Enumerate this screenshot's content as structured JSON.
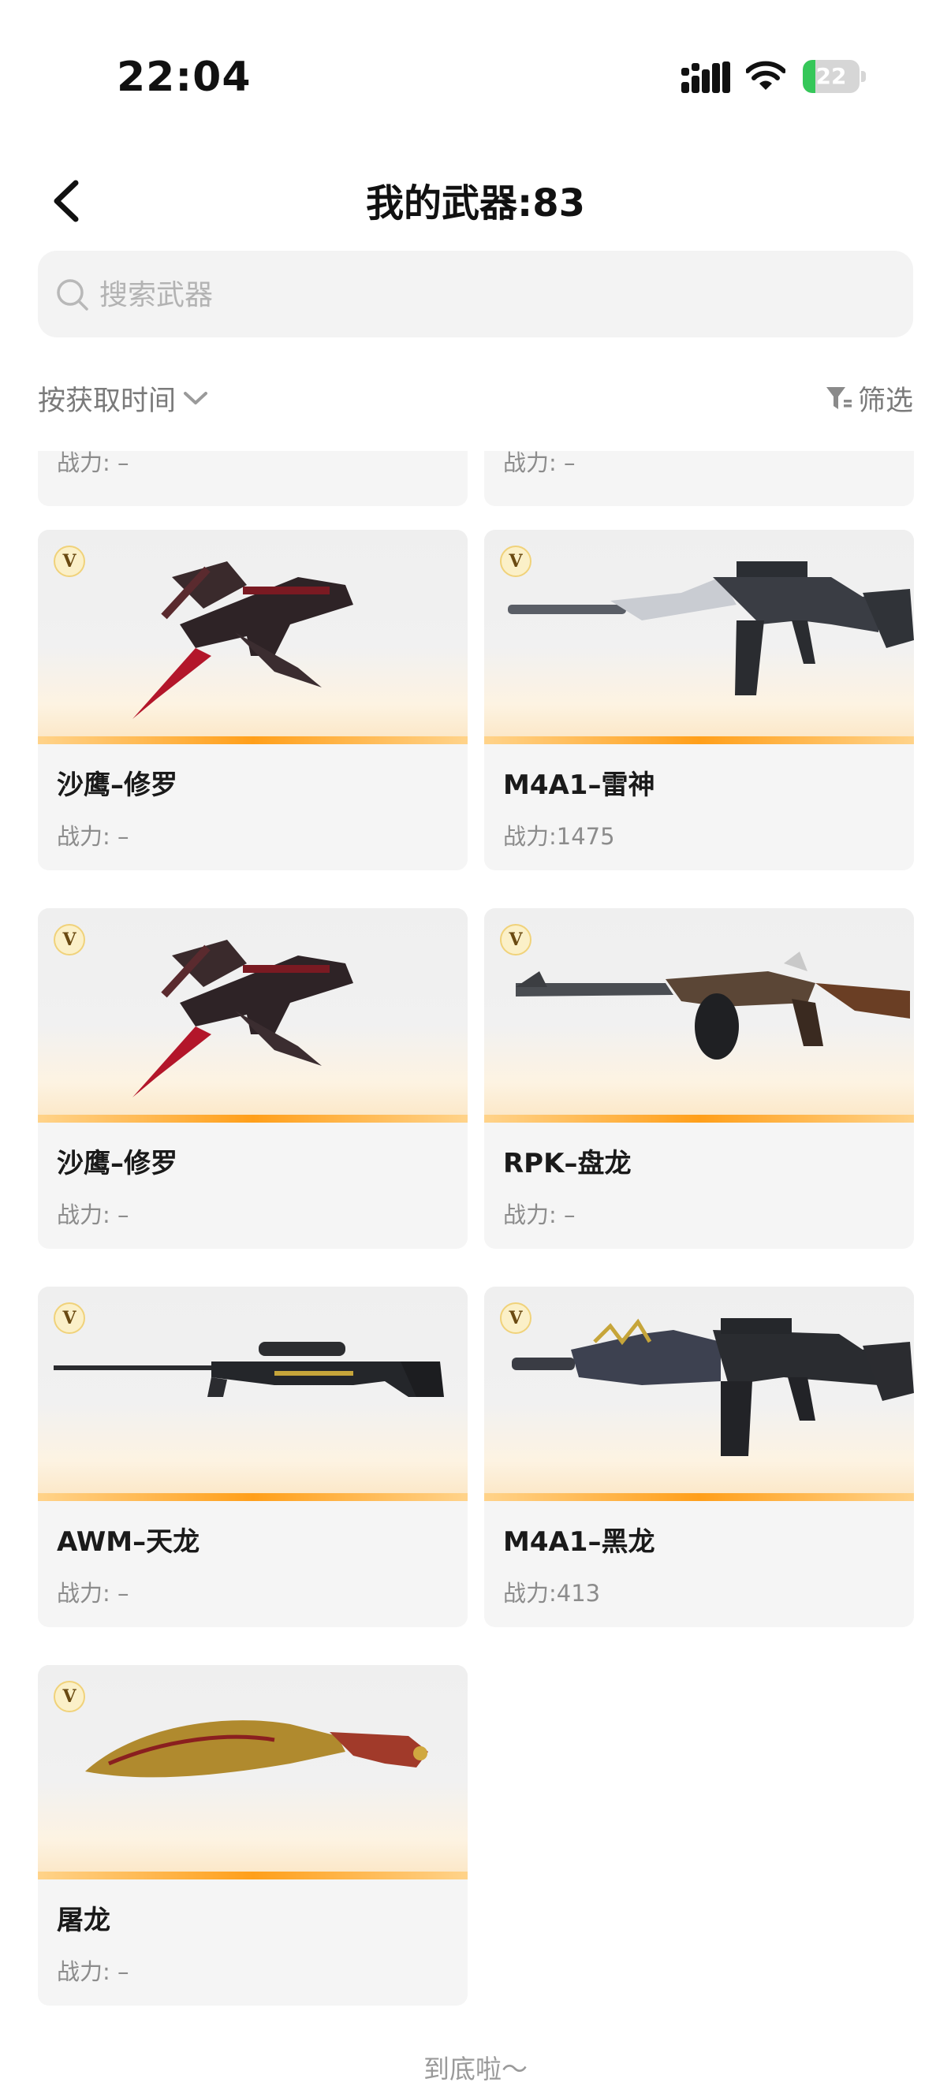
{
  "status_bar": {
    "time": "22:04",
    "battery_level": "22",
    "battery_fraction": 0.22,
    "icons": [
      "signal-icon",
      "wifi-icon",
      "battery-icon"
    ]
  },
  "header": {
    "title": "我的武器:83",
    "back_icon": "chevron-left-icon"
  },
  "search": {
    "placeholder": "搜索武器"
  },
  "toolbar": {
    "sort_label": "按获取时间",
    "filter_label": "筛选"
  },
  "partial_row": [
    {
      "power": "战力: –"
    },
    {
      "power": "战力: –"
    }
  ],
  "weapons": [
    {
      "name": "沙鹰–修罗",
      "power": "战力: –",
      "art": "pistol-dual"
    },
    {
      "name": "M4A1–雷神",
      "power": "战力:1475",
      "art": "rifle-silver"
    },
    {
      "name": "沙鹰–修罗",
      "power": "战力: –",
      "art": "pistol-dual"
    },
    {
      "name": "RPK–盘龙",
      "power": "战力: –",
      "art": "lmg-drum"
    },
    {
      "name": "AWM–天龙",
      "power": "战力: –",
      "art": "sniper"
    },
    {
      "name": "M4A1–黑龙",
      "power": "战力:413",
      "art": "rifle-dragon"
    },
    {
      "name": "屠龙",
      "power": "战力: –",
      "art": "kukri"
    }
  ],
  "badge_label": "V",
  "footer": {
    "end_text": "到底啦～"
  },
  "colors": {
    "accent_bar": "#ff9f1a",
    "card_bg": "#f5f5f5",
    "battery_green": "#35c759"
  }
}
